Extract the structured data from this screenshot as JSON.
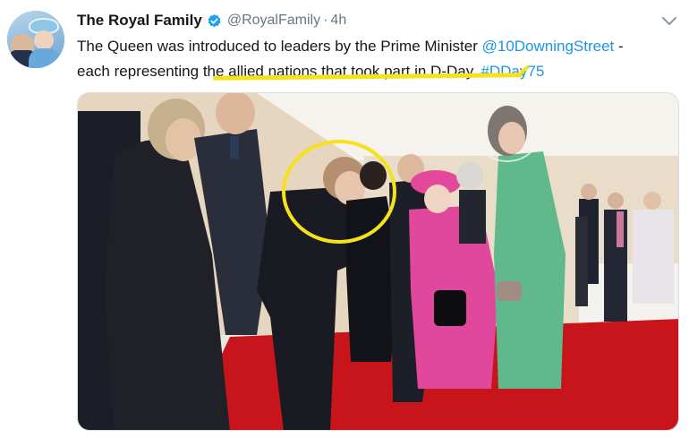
{
  "tweet": {
    "author_name": "The Royal Family",
    "handle": "@RoyalFamily",
    "separator": "·",
    "time": "4h",
    "text_line1_a": "The Queen was introduced to leaders by the Prime Minister ",
    "mention": "@10DowningStreet",
    "text_line1_b": " -",
    "text_line2_a": "each representing ",
    "text_line2_highlight": "the allied nations that took part in D-Day.",
    "text_line2_b": " ",
    "hashtag": "#DDay75"
  },
  "icons": {
    "verified": "verified-badge-icon",
    "menu": "chevron-down-icon"
  },
  "colors": {
    "link": "#1b95e0",
    "highlight": "#f5e21b",
    "carpet": "#c8141b",
    "verified": "#1da1f2"
  }
}
